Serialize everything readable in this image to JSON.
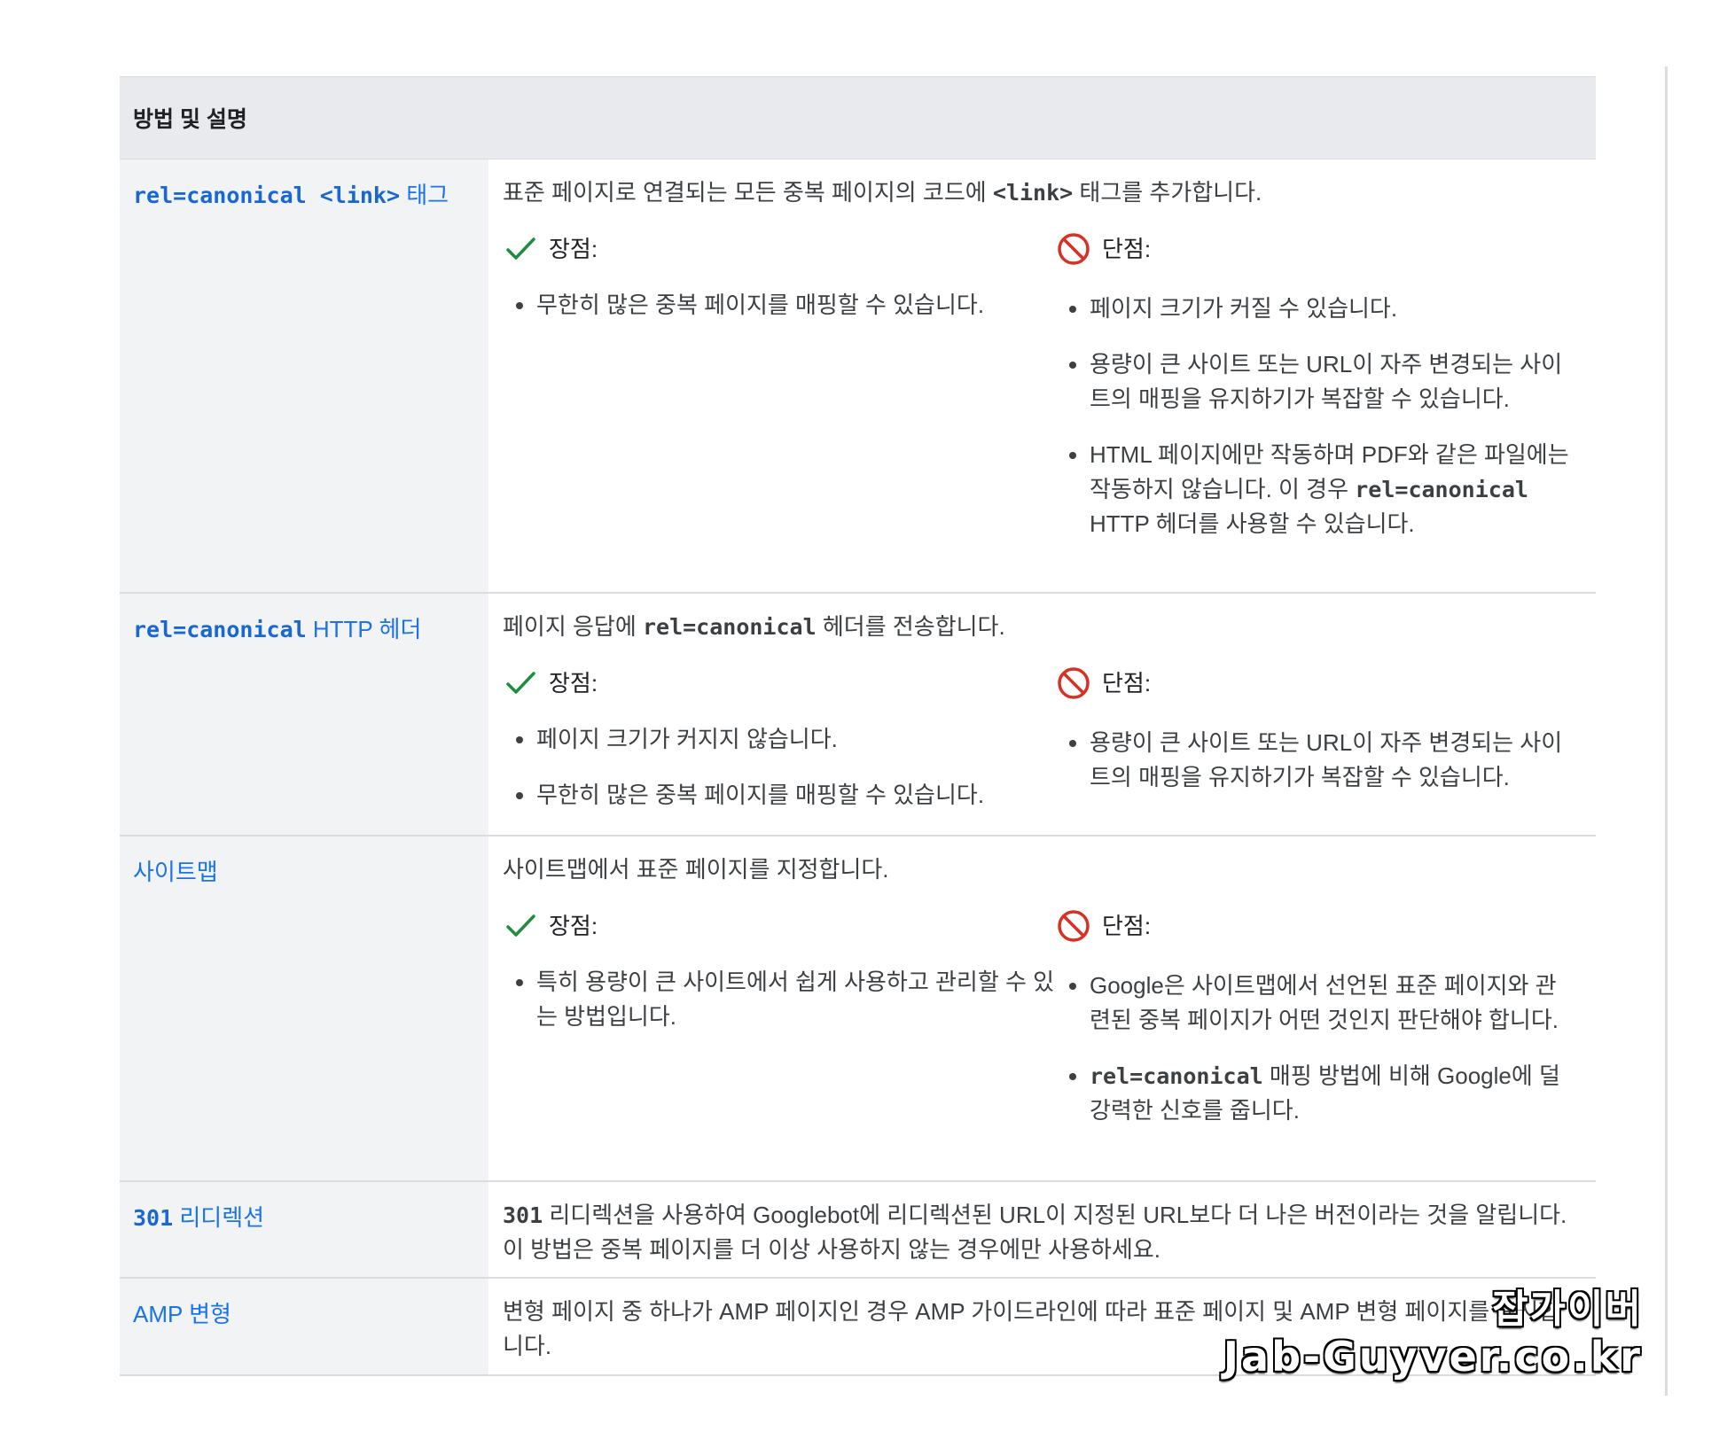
{
  "table": {
    "header": "방법 및 설명",
    "pros_label": "장점:",
    "cons_label": "단점:",
    "rows": [
      {
        "method_code": "rel=canonical <link>",
        "method_text": " 태그",
        "desc_pre": "표준 페이지로 연결되는 모든 중복 페이지의 코드에 ",
        "desc_code": "<link>",
        "desc_post": " 태그를 추가합니다.",
        "pros": [
          "무한히 많은 중복 페이지를 매핑할 수 있습니다."
        ],
        "cons": [
          {
            "pre": "페이지 크기가 커질 수 있습니다.",
            "code": "",
            "post": ""
          },
          {
            "pre": "용량이 큰 사이트 또는 URL이 자주 변경되는 사이트의 매핑을 유지하기가 복잡할 수 있습니다.",
            "code": "",
            "post": ""
          },
          {
            "pre": "HTML 페이지에만 작동하며 PDF와 같은 파일에는 작동하지 않습니다. 이 경우 ",
            "code": "rel=canonical",
            "post": " HTTP 헤더를 사용할 수 있습니다."
          }
        ]
      },
      {
        "method_code": "rel=canonical",
        "method_text": " HTTP 헤더",
        "desc_pre": "페이지 응답에 ",
        "desc_code": "rel=canonical",
        "desc_post": " 헤더를 전송합니다.",
        "pros": [
          "페이지 크기가 커지지 않습니다.",
          "무한히 많은 중복 페이지를 매핑할 수 있습니다."
        ],
        "cons": [
          {
            "pre": "용량이 큰 사이트 또는 URL이 자주 변경되는 사이트의 매핑을 유지하기가 복잡할 수 있습니다.",
            "code": "",
            "post": ""
          }
        ]
      },
      {
        "method_code": "",
        "method_text": "사이트맵",
        "desc_pre": "사이트맵에서 표준 페이지를 지정합니다.",
        "desc_code": "",
        "desc_post": "",
        "pros": [
          "특히 용량이 큰 사이트에서 쉽게 사용하고 관리할 수 있는 방법입니다."
        ],
        "cons": [
          {
            "pre": "Google은 사이트맵에서 선언된 표준 페이지와 관련된 중복 페이지가 어떤 것인지 판단해야 합니다.",
            "code": "",
            "post": ""
          },
          {
            "pre": "",
            "code": "rel=canonical",
            "post": " 매핑 방법에 비해 Google에 덜 강력한 신호를 줍니다."
          }
        ]
      },
      {
        "method_code": "301",
        "method_text": " 리디렉션",
        "desc_pre": "",
        "desc_code": "301",
        "desc_post": " 리디렉션을 사용하여 Googlebot에 리디렉션된 URL이 지정된 URL보다 더 나은 버전이라는 것을 알립니다. 이 방법은 중복 페이지를 더 이상 사용하지 않는 경우에만 사용하세요."
      },
      {
        "method_code": "",
        "method_text": "AMP 변형",
        "desc_pre": "변형 페이지 중 하나가 AMP 페이지인 경우 AMP 가이드라인에 따라 표준 페이지 및 AMP 변형 페이지를 표시합니다.",
        "desc_code": "",
        "desc_post": ""
      }
    ]
  },
  "watermark": {
    "line1": "잡가이버",
    "line2": "Jab-Guyver.co.kr"
  },
  "colors": {
    "link": "#1a73e8",
    "check": "#1e8e3e",
    "block": "#d93025",
    "header_bg": "#e8eaed",
    "method_bg": "#f1f3f4"
  },
  "icons": {
    "pros": "check-icon",
    "cons": "block-icon"
  }
}
